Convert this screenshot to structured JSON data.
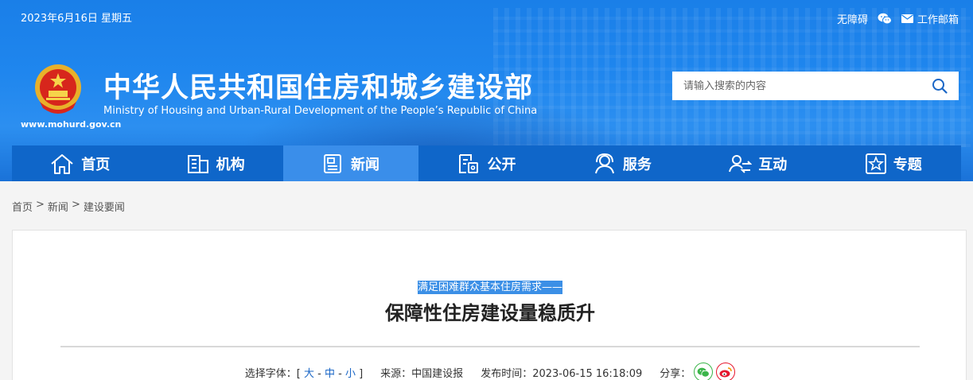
{
  "header": {
    "date": "2023年6月16日  星期五",
    "accessibility": "无障碍",
    "mailbox": "工作邮箱",
    "site_title": "中华人民共和国住房和城乡建设部",
    "site_subtitle": "Ministry of Housing and Urban-Rural Development of the People’s Republic of China",
    "site_url": "www.mohurd.gov.cn",
    "search_placeholder": "请输入搜索的内容"
  },
  "nav": {
    "items": [
      {
        "label": "首页",
        "icon": "home-icon"
      },
      {
        "label": "机构",
        "icon": "building-icon"
      },
      {
        "label": "新闻",
        "icon": "news-icon",
        "active": true
      },
      {
        "label": "公开",
        "icon": "document-icon"
      },
      {
        "label": "服务",
        "icon": "service-icon"
      },
      {
        "label": "互动",
        "icon": "interaction-icon"
      },
      {
        "label": "专题",
        "icon": "star-icon"
      }
    ]
  },
  "breadcrumb": {
    "items": [
      "首页",
      "新闻",
      "建设要闻"
    ],
    "separator": ">"
  },
  "article": {
    "kicker": "满足困难群众基本住房需求——",
    "title": "保障性住房建设量稳质升",
    "font_label": "选择字体：",
    "font_open": "[",
    "font_large": "大",
    "font_medium": "中",
    "font_small": "小",
    "font_dash": "-",
    "font_close": "]",
    "source": "来源：中国建设报",
    "publish_time": "发布时间：2023-06-15 16:18:09",
    "share_label": "分享："
  },
  "colors": {
    "header_blue": "#1f86ee",
    "nav_blue": "#0f66c9",
    "nav_active": "#3a8eea",
    "link_blue": "#1a66c6"
  }
}
